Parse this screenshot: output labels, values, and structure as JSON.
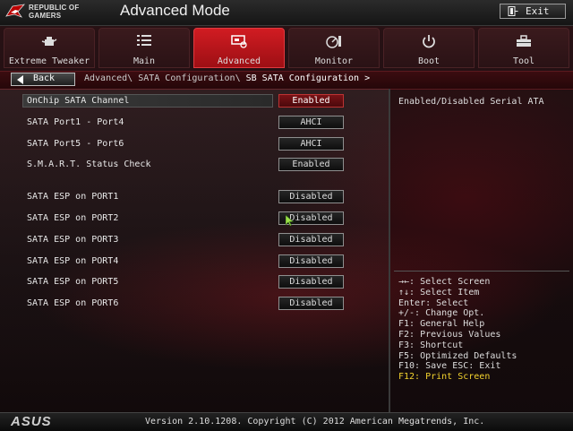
{
  "header": {
    "brand_line1": "REPUBLIC OF",
    "brand_line2": "GAMERS",
    "mode_title": "Advanced Mode",
    "exit_label": "Exit"
  },
  "tabs": [
    {
      "label": "Extreme Tweaker",
      "icon": "teapot-icon"
    },
    {
      "label": "Main",
      "icon": "list-icon"
    },
    {
      "label": "Advanced",
      "icon": "cpu-card-icon",
      "active": true
    },
    {
      "label": "Monitor",
      "icon": "gauge-icon"
    },
    {
      "label": "Boot",
      "icon": "power-icon"
    },
    {
      "label": "Tool",
      "icon": "toolbox-icon"
    }
  ],
  "nav": {
    "back_label": "Back",
    "breadcrumb_path": "Advanced\\ SATA Configuration\\ ",
    "breadcrumb_current": "SB SATA Configuration >"
  },
  "settings": [
    {
      "label": "OnChip SATA Channel",
      "value": "Enabled"
    },
    {
      "label": "SATA Port1 - Port4",
      "value": "AHCI"
    },
    {
      "label": "SATA Port5 - Port6",
      "value": "AHCI"
    },
    {
      "label": "S.M.A.R.T. Status Check",
      "value": "Enabled"
    },
    {
      "label": "SATA ESP on PORT1",
      "value": "Disabled"
    },
    {
      "label": "SATA ESP on PORT2",
      "value": "Disabled"
    },
    {
      "label": "SATA ESP on PORT3",
      "value": "Disabled"
    },
    {
      "label": "SATA ESP on PORT4",
      "value": "Disabled"
    },
    {
      "label": "SATA ESP on PORT5",
      "value": "Disabled"
    },
    {
      "label": "SATA ESP on PORT6",
      "value": "Disabled"
    }
  ],
  "help": {
    "description": "Enabled/Disabled Serial ATA",
    "keys": [
      "→←: Select Screen",
      "↑↓: Select Item",
      "Enter: Select",
      "+/-: Change Opt.",
      "F1: General Help",
      "F2: Previous Values",
      "F3: Shortcut",
      "F5: Optimized Defaults",
      "F10: Save  ESC: Exit",
      "F12: Print Screen"
    ]
  },
  "footer": {
    "logo_text": "ASUS",
    "version": "Version 2.10.1208. Copyright (C) 2012 American Megatrends, Inc."
  },
  "colors": {
    "accent_red": "#c8161d",
    "highlight_yellow": "#f2d22e"
  }
}
